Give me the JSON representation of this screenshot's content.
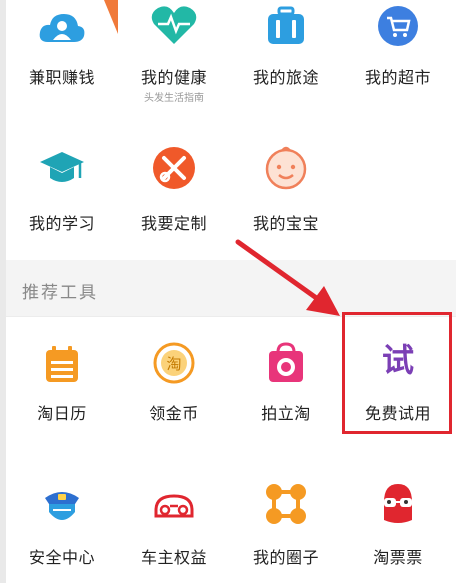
{
  "colors": {
    "accent_red": "#e0262f",
    "section_bg": "#f4f4f4",
    "icon_blue": "#2d9ee0",
    "icon_teal": "#22b8a6",
    "icon_orange": "#f59a23",
    "icon_pink": "#e8357a",
    "icon_purple": "#7b3fb5"
  },
  "row1": [
    {
      "label": "兼职赚钱",
      "icon": "cloud-person-icon"
    },
    {
      "label": "我的健康",
      "sublabel": "头发生活指南",
      "icon": "heart-pulse-icon"
    },
    {
      "label": "我的旅途",
      "icon": "luggage-icon"
    },
    {
      "label": "我的超市",
      "icon": "cart-icon"
    }
  ],
  "row2": [
    {
      "label": "我的学习",
      "icon": "graduation-cap-icon"
    },
    {
      "label": "我要定制",
      "icon": "scissors-pencil-icon"
    },
    {
      "label": "我的宝宝",
      "icon": "baby-face-icon"
    }
  ],
  "section": {
    "title": "推荐工具"
  },
  "row3": [
    {
      "label": "淘日历",
      "icon": "calendar-icon"
    },
    {
      "label": "领金币",
      "icon": "gold-coin-icon"
    },
    {
      "label": "拍立淘",
      "icon": "camera-bag-icon"
    },
    {
      "label": "免费试用",
      "icon": "trial-icon",
      "glyph": "试"
    }
  ],
  "row4": [
    {
      "label": "安全中心",
      "icon": "security-guard-icon"
    },
    {
      "label": "车主权益",
      "icon": "car-icon"
    },
    {
      "label": "我的圈子",
      "icon": "circle-network-icon"
    },
    {
      "label": "淘票票",
      "icon": "glasses-mascot-icon"
    }
  ]
}
